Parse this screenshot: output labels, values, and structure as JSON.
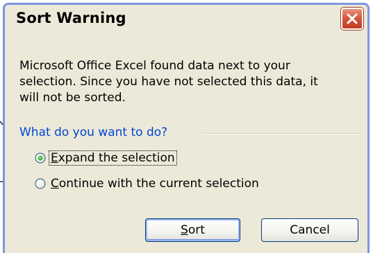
{
  "dialog": {
    "title": "Sort Warning",
    "close_icon": "close-icon"
  },
  "message": {
    "line1": "Microsoft Office Excel found data next to your",
    "line2": "selection.  Since you have not selected this data, it",
    "line3": "will not be sorted."
  },
  "options": {
    "legend": "What do you want to do?",
    "expand": {
      "mnemonic": "E",
      "rest": "xpand the selection",
      "checked": true
    },
    "continue": {
      "mnemonic": "C",
      "rest": "ontinue with the current selection",
      "checked": false
    }
  },
  "buttons": {
    "sort": {
      "mnemonic": "S",
      "rest": "ort"
    },
    "cancel": {
      "label": "Cancel"
    }
  },
  "colors": {
    "window_border": "#7A96DF",
    "dialog_bg": "#ECE9D8",
    "legend_text": "#0046D5",
    "radio_selected": "#21A121",
    "close_button": "#D2553A"
  }
}
